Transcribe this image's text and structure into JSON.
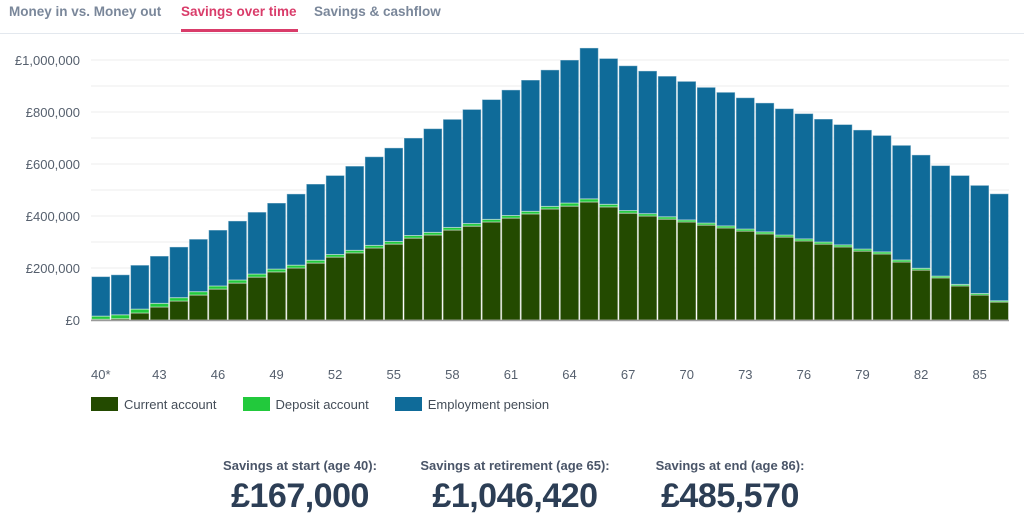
{
  "tabs": [
    {
      "label": "Money in vs. Money out",
      "active": false
    },
    {
      "label": "Savings over time",
      "active": true
    },
    {
      "label": "Savings & cashflow",
      "active": false
    }
  ],
  "colors": {
    "accent": "#d93c6a",
    "current_account": "#234a00",
    "deposit_account": "#22c93c",
    "employment_pension": "#0f6b99"
  },
  "chart_data": {
    "type": "bar",
    "stacked": true,
    "title": "",
    "xlabel": "",
    "ylabel": "",
    "ylim": [
      0,
      1000000
    ],
    "yticks": [
      0,
      200000,
      400000,
      600000,
      800000,
      1000000
    ],
    "ytick_labels": [
      "£0",
      "£200,000",
      "£400,000",
      "£600,000",
      "£800,000",
      "£1,000,000"
    ],
    "grid": true,
    "legend_position": "bottom-left",
    "categories": [
      40,
      41,
      42,
      43,
      44,
      45,
      46,
      47,
      48,
      49,
      50,
      51,
      52,
      53,
      54,
      55,
      56,
      57,
      58,
      59,
      60,
      61,
      62,
      63,
      64,
      65,
      66,
      67,
      68,
      69,
      70,
      71,
      72,
      73,
      74,
      75,
      76,
      77,
      78,
      79,
      80,
      81,
      82,
      83,
      84,
      85,
      86
    ],
    "xtick_labels": [
      {
        "age": 40,
        "label": "40*"
      },
      {
        "age": 43,
        "label": "43"
      },
      {
        "age": 46,
        "label": "46"
      },
      {
        "age": 49,
        "label": "49"
      },
      {
        "age": 52,
        "label": "52"
      },
      {
        "age": 55,
        "label": "55"
      },
      {
        "age": 58,
        "label": "58"
      },
      {
        "age": 61,
        "label": "61"
      },
      {
        "age": 64,
        "label": "64"
      },
      {
        "age": 67,
        "label": "67"
      },
      {
        "age": 70,
        "label": "70"
      },
      {
        "age": 73,
        "label": "73"
      },
      {
        "age": 76,
        "label": "76"
      },
      {
        "age": 79,
        "label": "79"
      },
      {
        "age": 82,
        "label": "82"
      },
      {
        "age": 85,
        "label": "85"
      }
    ],
    "series": [
      {
        "name": "Current account",
        "color": "#234a00",
        "values": [
          3000,
          5000,
          27000,
          50000,
          73000,
          96000,
          119000,
          142000,
          165000,
          185000,
          200000,
          219000,
          242000,
          258000,
          277000,
          292000,
          315000,
          327000,
          346000,
          361000,
          377000,
          392000,
          408000,
          427000,
          438000,
          454000,
          435000,
          411000,
          400000,
          388000,
          377000,
          365000,
          354000,
          342000,
          331000,
          319000,
          304000,
          292000,
          281000,
          265000,
          254000,
          223000,
          192000,
          162000,
          131000,
          96000,
          69000
        ]
      },
      {
        "name": "Deposit account",
        "color": "#22c93c",
        "values": [
          12000,
          15000,
          15000,
          14000,
          13000,
          13000,
          12000,
          12000,
          12000,
          11000,
          11000,
          11000,
          10000,
          10000,
          10000,
          10000,
          10000,
          10000,
          10000,
          10000,
          10000,
          10000,
          10000,
          10000,
          12000,
          12000,
          10000,
          10000,
          9000,
          9000,
          8000,
          8000,
          8000,
          8000,
          8000,
          8000,
          8000,
          8000,
          8000,
          8000,
          8000,
          8000,
          7000,
          7000,
          6000,
          6000,
          5000
        ]
      },
      {
        "name": "Employment pension",
        "color": "#0f6b99",
        "values": [
          152000,
          154000,
          169000,
          182000,
          195000,
          202000,
          215000,
          227000,
          238000,
          254000,
          274000,
          293000,
          304000,
          324000,
          341000,
          360000,
          375000,
          399000,
          416000,
          439000,
          461000,
          483000,
          505000,
          525000,
          550000,
          580420,
          561000,
          557000,
          549000,
          541000,
          533000,
          522000,
          514000,
          505000,
          496000,
          486000,
          482000,
          473000,
          463000,
          458000,
          448000,
          441000,
          436000,
          425000,
          419000,
          416000,
          411570
        ]
      }
    ]
  },
  "legend": [
    {
      "label": "Current account",
      "color": "#234a00"
    },
    {
      "label": "Deposit account",
      "color": "#22c93c"
    },
    {
      "label": "Employment pension",
      "color": "#0f6b99"
    }
  ],
  "summary": [
    {
      "label": "Savings at start (age 40):",
      "value": "£167,000"
    },
    {
      "label": "Savings at retirement (age 65):",
      "value": "£1,046,420"
    },
    {
      "label": "Savings at end (age 86):",
      "value": "£485,570"
    }
  ]
}
